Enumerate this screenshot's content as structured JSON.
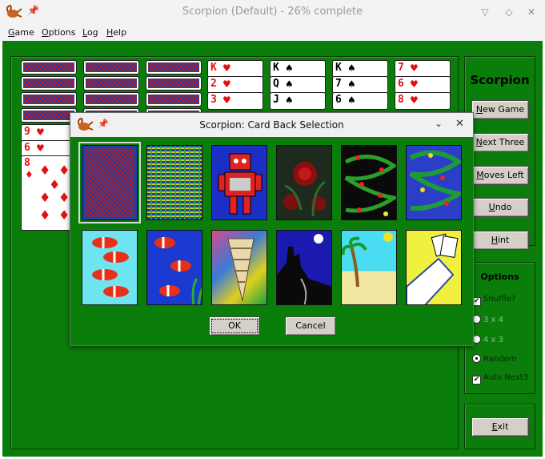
{
  "window": {
    "title": "Scorpion (Default) - 26% complete"
  },
  "menu": [
    "Game",
    "Options",
    "Log",
    "Help"
  ],
  "side": {
    "title": "Scorpion",
    "buttons": [
      "New Game",
      "Next Three",
      "Moves Left",
      "Undo",
      "Hint"
    ],
    "exit": "Exit"
  },
  "options": {
    "title": "Options",
    "shuffle": "Shuffle?",
    "r3x4": "3 x 4",
    "r4x3": "4 x 3",
    "random": "Random",
    "auto_next3": "Auto Next3"
  },
  "tableau": {
    "col4": [
      {
        "rank": "K",
        "suit": "♥"
      },
      {
        "rank": "2",
        "suit": "♥"
      },
      {
        "rank": "3",
        "suit": "♥"
      }
    ],
    "col5": [
      {
        "rank": "K",
        "suit": "♠"
      },
      {
        "rank": "Q",
        "suit": "♠"
      },
      {
        "rank": "J",
        "suit": "♠"
      }
    ],
    "col6": [
      {
        "rank": "K",
        "suit": "♠"
      },
      {
        "rank": "7",
        "suit": "♠"
      },
      {
        "rank": "6",
        "suit": "♠"
      }
    ],
    "col7": [
      {
        "rank": "7",
        "suit": "♥"
      },
      {
        "rank": "6",
        "suit": "♥"
      },
      {
        "rank": "8",
        "suit": "♥"
      }
    ],
    "col1": [
      {
        "rank": "9",
        "suit": "♥"
      },
      {
        "rank": "6",
        "suit": "♥"
      },
      {
        "rank": "8",
        "suit": "♦"
      }
    ]
  },
  "dialog": {
    "title": "Scorpion: Card Back Selection",
    "ok": "OK",
    "cancel": "Cancel",
    "backs": [
      "blue-red weave",
      "green-yellow lattice",
      "red robot",
      "red roses",
      "holly berries",
      "green vines on blue",
      "clownfish on cyan",
      "clownfish on blue",
      "seashell",
      "castle at night",
      "palm tree beach",
      "hand of cards"
    ]
  },
  "colors": {
    "table": "#0b7d0b",
    "red": "#e31010"
  }
}
